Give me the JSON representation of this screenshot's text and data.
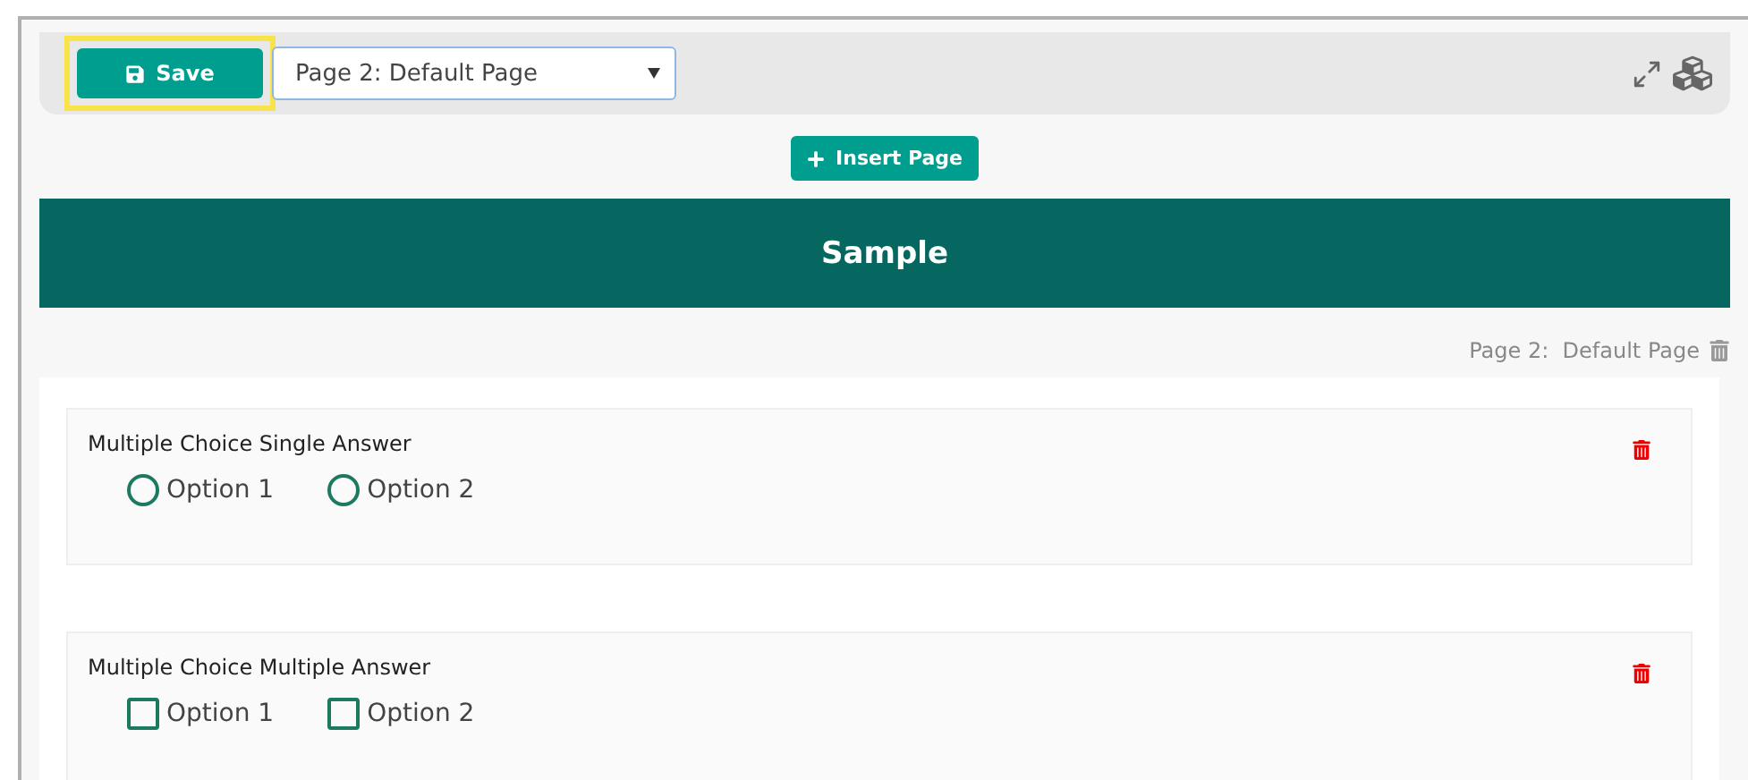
{
  "toolbar": {
    "save_label": "Save",
    "highlighted": true,
    "page_select": {
      "value": "Page 2: Default Page"
    }
  },
  "insert_button": "Insert Page",
  "banner": {
    "title": "Sample"
  },
  "page_label": "Page 2:  Default Page",
  "questions": [
    {
      "kind": "radio",
      "title": "Multiple Choice Single Answer",
      "options": [
        {
          "label": "Option 1",
          "selected": false
        },
        {
          "label": "Option 2",
          "selected": false
        }
      ]
    },
    {
      "kind": "checkbox",
      "title": "Multiple Choice Multiple Answer",
      "options": [
        {
          "label": "Option 1",
          "checked": false
        },
        {
          "label": "Option 2",
          "checked": false
        }
      ]
    }
  ]
}
